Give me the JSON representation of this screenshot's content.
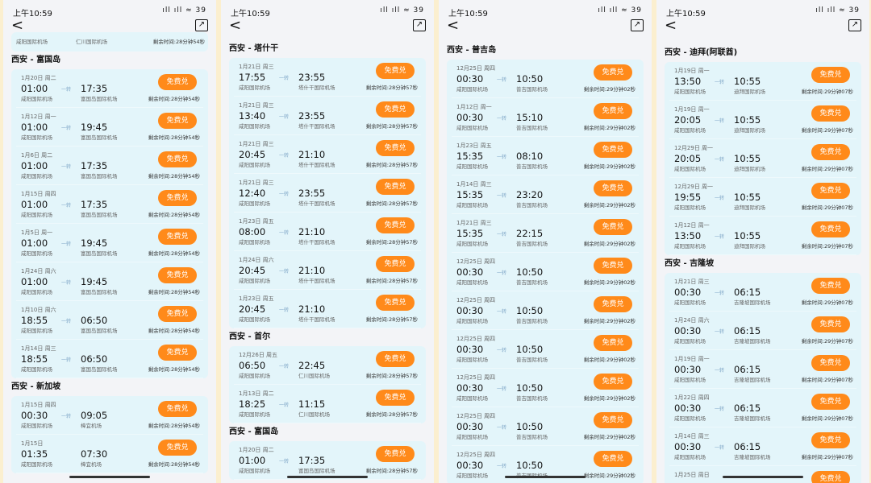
{
  "status": {
    "time": "上午10:59",
    "signal": "ıll ıll ≈",
    "battery": "39"
  },
  "nav": {
    "back": "<",
    "share": "↗"
  },
  "panels": [
    {
      "remain": "剩余时间:28分钟54秒",
      "top_snip": {
        "depap": "咸阳国际机场",
        "arrap": "仁川国际机场"
      },
      "sections": [
        {
          "title": "西安 - 富国岛",
          "rows": [
            {
              "date": "1月20日 周二",
              "dep": "01:00",
              "depap": "咸阳国际机场",
              "via": "一转",
              "arr": "17:35",
              "arrap": "富国岛国际机场"
            },
            {
              "date": "1月12日 周一",
              "dep": "01:00",
              "depap": "咸阳国际机场",
              "via": "一转",
              "arr": "19:45",
              "arrap": "富国岛国际机场"
            },
            {
              "date": "1月6日 周二",
              "dep": "01:00",
              "depap": "咸阳国际机场",
              "via": "一转",
              "arr": "17:35",
              "arrap": "富国岛国际机场"
            },
            {
              "date": "1月15日 周四",
              "dep": "01:00",
              "depap": "咸阳国际机场",
              "via": "一转",
              "arr": "17:35",
              "arrap": "富国岛国际机场"
            },
            {
              "date": "1月5日 周一",
              "dep": "01:00",
              "depap": "咸阳国际机场",
              "via": "一转",
              "arr": "19:45",
              "arrap": "富国岛国际机场"
            },
            {
              "date": "1月24日 周六",
              "dep": "01:00",
              "depap": "咸阳国际机场",
              "via": "一转",
              "arr": "19:45",
              "arrap": "富国岛国际机场"
            },
            {
              "date": "1月10日 周六",
              "dep": "18:55",
              "depap": "咸阳国际机场",
              "via": "一转",
              "arr": "06:50",
              "arrap": "富国岛国际机场"
            },
            {
              "date": "1月14日 周三",
              "dep": "18:55",
              "depap": "咸阳国际机场",
              "via": "一转",
              "arr": "06:50",
              "arrap": "富国岛国际机场"
            }
          ]
        },
        {
          "title": "西安 - 新加坡",
          "rows": [
            {
              "date": "1月15日 周四",
              "dep": "00:30",
              "depap": "咸阳国际机场",
              "via": "一转",
              "arr": "09:05",
              "arrap": "樟宜机场"
            },
            {
              "date": "1月15日",
              "dep": "01:35",
              "depap": "咸阳国际机场",
              "via": "",
              "arr": "07:30",
              "arrap": "樟宜机场"
            }
          ]
        }
      ]
    },
    {
      "remain": "剩余时间:28分钟57秒",
      "sections": [
        {
          "title": "西安 - 塔什干",
          "rows": [
            {
              "date": "1月21日 周三",
              "dep": "17:55",
              "depap": "咸阳国际机场",
              "via": "一转",
              "arr": "23:55",
              "arrap": "塔什干国际机场"
            },
            {
              "date": "1月21日 周三",
              "dep": "13:40",
              "depap": "咸阳国际机场",
              "via": "一转",
              "arr": "23:55",
              "arrap": "塔什干国际机场"
            },
            {
              "date": "1月21日 周三",
              "dep": "20:45",
              "depap": "咸阳国际机场",
              "via": "一转",
              "arr": "21:10",
              "arrap": "塔什干国际机场"
            },
            {
              "date": "1月21日 周三",
              "dep": "12:40",
              "depap": "咸阳国际机场",
              "via": "一转",
              "arr": "23:55",
              "arrap": "塔什干国际机场"
            },
            {
              "date": "1月23日 周五",
              "dep": "08:00",
              "depap": "咸阳国际机场",
              "via": "一转",
              "arr": "21:10",
              "arrap": "塔什干国际机场"
            },
            {
              "date": "1月24日 周六",
              "dep": "20:45",
              "depap": "咸阳国际机场",
              "via": "一转",
              "arr": "21:10",
              "arrap": "塔什干国际机场"
            },
            {
              "date": "1月23日 周五",
              "dep": "20:45",
              "depap": "咸阳国际机场",
              "via": "一转",
              "arr": "21:10",
              "arrap": "塔什干国际机场"
            }
          ]
        },
        {
          "title": "西安 - 首尔",
          "rows": [
            {
              "date": "12月26日 周五",
              "dep": "06:50",
              "depap": "咸阳国际机场",
              "via": "一转",
              "arr": "22:45",
              "arrap": "仁川国际机场"
            },
            {
              "date": "1月13日 周二",
              "dep": "18:25",
              "depap": "咸阳国际机场",
              "via": "一转",
              "arr": "11:15",
              "arrap": "仁川国际机场"
            }
          ]
        },
        {
          "title": "西安 - 富国岛",
          "rows": [
            {
              "date": "1月20日 周二",
              "dep": "01:00",
              "depap": "咸阳国际机场",
              "via": "一转",
              "arr": "17:35",
              "arrap": "富国岛国际机场"
            }
          ]
        }
      ]
    },
    {
      "remain": "剩余时间:29分钟02秒",
      "sections": [
        {
          "title": "西安 - 普吉岛",
          "rows": [
            {
              "date": "12月25日 周四",
              "dep": "00:30",
              "depap": "咸阳国际机场",
              "via": "一转",
              "arr": "10:50",
              "arrap": "普吉国际机场"
            },
            {
              "date": "1月12日 周一",
              "dep": "00:30",
              "depap": "咸阳国际机场",
              "via": "一转",
              "arr": "15:10",
              "arrap": "普吉国际机场"
            },
            {
              "date": "1月23日 周五",
              "dep": "15:35",
              "depap": "咸阳国际机场",
              "via": "一转",
              "arr": "08:10",
              "arrap": "普吉国际机场"
            },
            {
              "date": "1月14日 周三",
              "dep": "15:35",
              "depap": "咸阳国际机场",
              "via": "一转",
              "arr": "23:20",
              "arrap": "普吉国际机场"
            },
            {
              "date": "1月21日 周三",
              "dep": "15:35",
              "depap": "咸阳国际机场",
              "via": "一转",
              "arr": "22:15",
              "arrap": "普吉国际机场"
            },
            {
              "date": "12月25日 周四",
              "dep": "00:30",
              "depap": "咸阳国际机场",
              "via": "一转",
              "arr": "10:50",
              "arrap": "普吉国际机场"
            },
            {
              "date": "12月25日 周四",
              "dep": "00:30",
              "depap": "咸阳国际机场",
              "via": "一转",
              "arr": "10:50",
              "arrap": "普吉国际机场"
            },
            {
              "date": "12月25日 周四",
              "dep": "00:30",
              "depap": "咸阳国际机场",
              "via": "一转",
              "arr": "10:50",
              "arrap": "普吉国际机场"
            },
            {
              "date": "12月25日 周四",
              "dep": "00:30",
              "depap": "咸阳国际机场",
              "via": "一转",
              "arr": "10:50",
              "arrap": "普吉国际机场"
            },
            {
              "date": "12月25日 周四",
              "dep": "00:30",
              "depap": "咸阳国际机场",
              "via": "一转",
              "arr": "10:50",
              "arrap": "普吉国际机场"
            },
            {
              "date": "12月25日 周四",
              "dep": "00:30",
              "depap": "咸阳国际机场",
              "via": "一转",
              "arr": "10:50",
              "arrap": "普吉国际机场"
            }
          ]
        }
      ]
    },
    {
      "remain": "剩余时间:29分钟07秒",
      "sections": [
        {
          "title": "西安 - 迪拜(阿联酋)",
          "rows": [
            {
              "date": "1月19日 周一",
              "dep": "13:50",
              "depap": "咸阳国际机场",
              "via": "一转",
              "arr": "10:55",
              "arrap": "迪拜国际机场"
            },
            {
              "date": "1月19日 周一",
              "dep": "20:05",
              "depap": "咸阳国际机场",
              "via": "一转",
              "arr": "10:55",
              "arrap": "迪拜国际机场"
            },
            {
              "date": "12月29日 周一",
              "dep": "20:05",
              "depap": "咸阳国际机场",
              "via": "一转",
              "arr": "10:55",
              "arrap": "迪拜国际机场"
            },
            {
              "date": "12月29日 周一",
              "dep": "19:55",
              "depap": "咸阳国际机场",
              "via": "一转",
              "arr": "10:55",
              "arrap": "迪拜国际机场"
            },
            {
              "date": "1月12日 周一",
              "dep": "13:50",
              "depap": "咸阳国际机场",
              "via": "一转",
              "arr": "10:55",
              "arrap": "迪拜国际机场"
            }
          ]
        },
        {
          "title": "西安 - 吉隆坡",
          "rows": [
            {
              "date": "1月21日 周三",
              "dep": "00:30",
              "depap": "咸阳国际机场",
              "via": "一转",
              "arr": "06:15",
              "arrap": "吉隆坡国际机场"
            },
            {
              "date": "1月24日 周六",
              "dep": "00:30",
              "depap": "咸阳国际机场",
              "via": "一转",
              "arr": "06:15",
              "arrap": "吉隆坡国际机场"
            },
            {
              "date": "1月19日 周一",
              "dep": "00:30",
              "depap": "咸阳国际机场",
              "via": "一转",
              "arr": "06:15",
              "arrap": "吉隆坡国际机场"
            },
            {
              "date": "1月22日 周四",
              "dep": "00:30",
              "depap": "咸阳国际机场",
              "via": "一转",
              "arr": "06:15",
              "arrap": "吉隆坡国际机场"
            },
            {
              "date": "1月14日 周三",
              "dep": "00:30",
              "depap": "咸阳国际机场",
              "via": "一转",
              "arr": "06:15",
              "arrap": "吉隆坡国际机场"
            },
            {
              "date": "1月25日 周日",
              "dep": "",
              "depap": "",
              "via": "",
              "arr": "",
              "arrap": ""
            }
          ]
        }
      ]
    }
  ],
  "button_label": "免费兑"
}
